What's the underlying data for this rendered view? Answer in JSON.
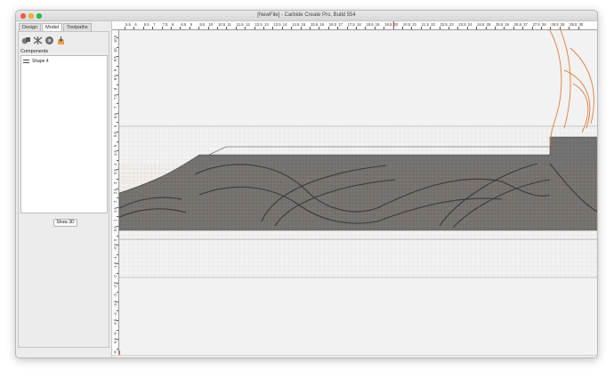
{
  "window": {
    "title": "[NewFile] - Carbide Create Pro, Build 554"
  },
  "tabs": [
    {
      "label": "Design",
      "active": false
    },
    {
      "label": "Model",
      "active": true
    },
    {
      "label": "Toolpaths",
      "active": false
    }
  ],
  "model_tools": [
    {
      "icon": "union-shapes-icon"
    },
    {
      "icon": "pattern-icon"
    },
    {
      "icon": "sphere-icon"
    },
    {
      "icon": "import-model-icon"
    }
  ],
  "components": {
    "label": "Components",
    "items": [
      {
        "label": "Shape 4"
      }
    ]
  },
  "show3d_label": "Show 3D",
  "ruler": {
    "h_labels": [
      "5.5",
      "6",
      "6.5",
      "7",
      "7.5",
      "8",
      "8.5",
      "9",
      "9.5",
      "10",
      "10.5",
      "11",
      "11.5",
      "12",
      "12.5",
      "13",
      "13.5",
      "14",
      "14.5",
      "15",
      "15.5",
      "16",
      "16.5",
      "17",
      "17.5",
      "18",
      "18.5",
      "19",
      "19.5",
      "20",
      "20.5",
      "21",
      "21.5",
      "22",
      "22.5",
      "23",
      "23.5",
      "24",
      "24.5",
      "25",
      "25.5",
      "26",
      "26.5",
      "27",
      "27.5",
      "28",
      "28.5",
      "29",
      "29.5",
      "30"
    ],
    "v_labels": [
      "10.5",
      "10",
      "9.5",
      "9",
      "8.5",
      "8",
      "7.5",
      "7",
      "6.5",
      "6",
      "5.5",
      "5",
      "4.5",
      "4",
      "3.5",
      "3",
      "2.5",
      "2",
      "1.5",
      "1",
      "0.5",
      "0",
      "-0.5",
      "-1",
      "-1.5",
      "-2",
      "-2.5",
      "-3",
      "-3.5",
      "-4",
      "-4.5",
      "-5",
      "-5.5",
      "-6",
      "-6.5"
    ],
    "marker_color": "#d42a2a"
  },
  "colors": {
    "accent_orange": "#e07b39",
    "band_fill": "#6e6e6e",
    "grid": "#d0d0d0"
  }
}
